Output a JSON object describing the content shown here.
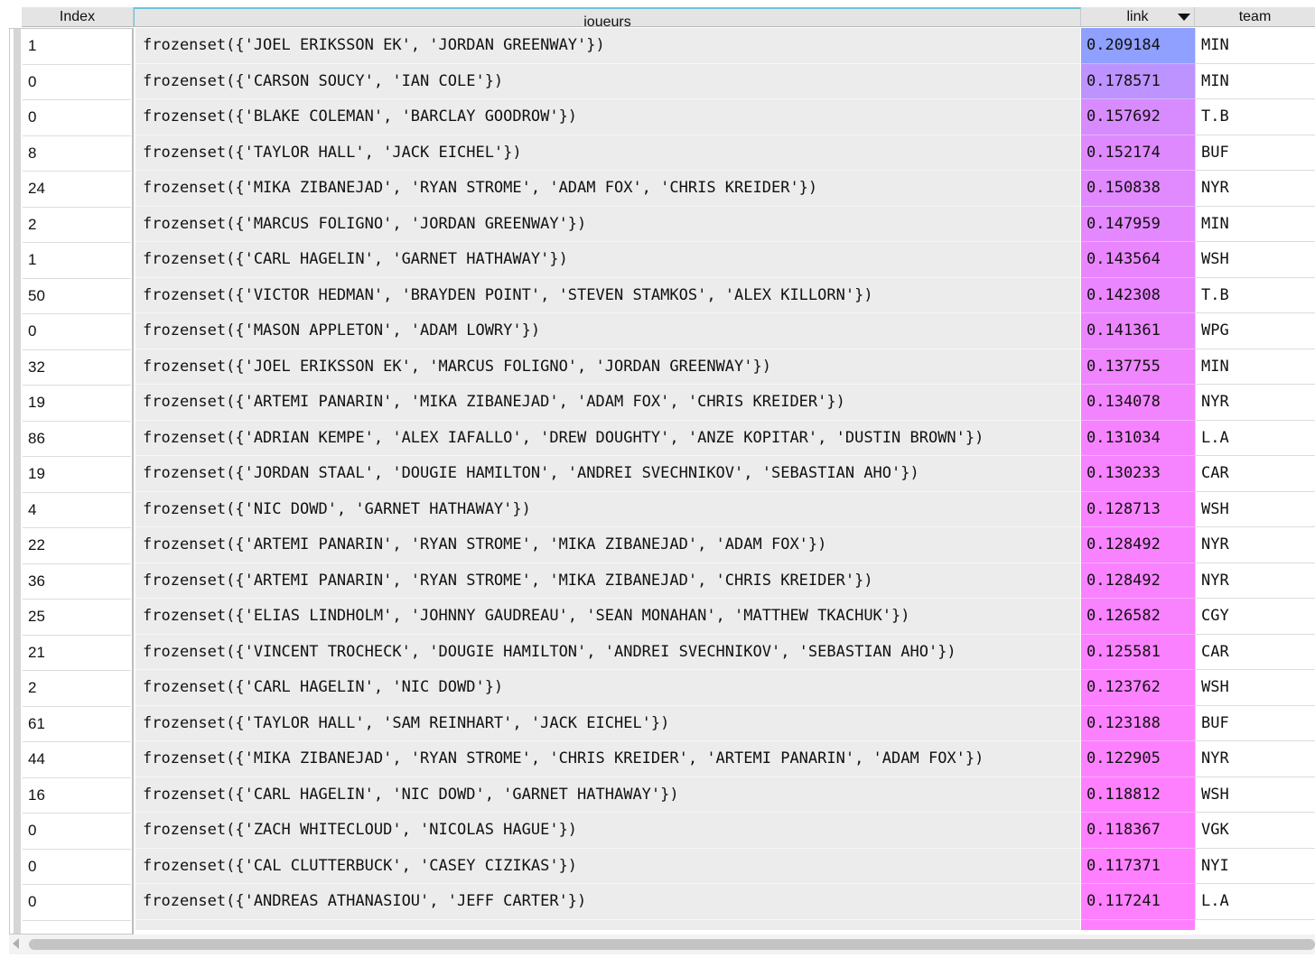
{
  "columns": {
    "index": "Index",
    "joueurs": "joueurs",
    "link": "link",
    "team": "team"
  },
  "colors": {
    "header_accent": "#6fc3d9",
    "link_low": "#ff80ff",
    "link_high": "#8fa0ff"
  },
  "rows": [
    {
      "index": "1",
      "joueurs": "frozenset({'JOEL ERIKSSON EK', 'JORDAN GREENWAY'})",
      "link": "0.209184",
      "team": "MIN"
    },
    {
      "index": "0",
      "joueurs": "frozenset({'CARSON SOUCY', 'IAN COLE'})",
      "link": "0.178571",
      "team": "MIN"
    },
    {
      "index": "0",
      "joueurs": "frozenset({'BLAKE COLEMAN', 'BARCLAY GOODROW'})",
      "link": "0.157692",
      "team": "T.B"
    },
    {
      "index": "8",
      "joueurs": "frozenset({'TAYLOR HALL', 'JACK EICHEL'})",
      "link": "0.152174",
      "team": "BUF"
    },
    {
      "index": "24",
      "joueurs": "frozenset({'MIKA ZIBANEJAD', 'RYAN STROME', 'ADAM FOX', 'CHRIS KREIDER'})",
      "link": "0.150838",
      "team": "NYR"
    },
    {
      "index": "2",
      "joueurs": "frozenset({'MARCUS FOLIGNO', 'JORDAN GREENWAY'})",
      "link": "0.147959",
      "team": "MIN"
    },
    {
      "index": "1",
      "joueurs": "frozenset({'CARL HAGELIN', 'GARNET HATHAWAY'})",
      "link": "0.143564",
      "team": "WSH"
    },
    {
      "index": "50",
      "joueurs": "frozenset({'VICTOR HEDMAN', 'BRAYDEN POINT', 'STEVEN STAMKOS', 'ALEX KILLORN'})",
      "link": "0.142308",
      "team": "T.B"
    },
    {
      "index": "0",
      "joueurs": "frozenset({'MASON APPLETON', 'ADAM LOWRY'})",
      "link": "0.141361",
      "team": "WPG"
    },
    {
      "index": "32",
      "joueurs": "frozenset({'JOEL ERIKSSON EK', 'MARCUS FOLIGNO', 'JORDAN GREENWAY'})",
      "link": "0.137755",
      "team": "MIN"
    },
    {
      "index": "19",
      "joueurs": "frozenset({'ARTEMI PANARIN', 'MIKA ZIBANEJAD', 'ADAM FOX', 'CHRIS KREIDER'})",
      "link": "0.134078",
      "team": "NYR"
    },
    {
      "index": "86",
      "joueurs": "frozenset({'ADRIAN KEMPE', 'ALEX IAFALLO', 'DREW DOUGHTY', 'ANZE KOPITAR', 'DUSTIN BROWN'})",
      "link": "0.131034",
      "team": "L.A"
    },
    {
      "index": "19",
      "joueurs": "frozenset({'JORDAN STAAL', 'DOUGIE HAMILTON', 'ANDREI SVECHNIKOV', 'SEBASTIAN AHO'})",
      "link": "0.130233",
      "team": "CAR"
    },
    {
      "index": "4",
      "joueurs": "frozenset({'NIC DOWD', 'GARNET HATHAWAY'})",
      "link": "0.128713",
      "team": "WSH"
    },
    {
      "index": "22",
      "joueurs": "frozenset({'ARTEMI PANARIN', 'RYAN STROME', 'MIKA ZIBANEJAD', 'ADAM FOX'})",
      "link": "0.128492",
      "team": "NYR"
    },
    {
      "index": "36",
      "joueurs": "frozenset({'ARTEMI PANARIN', 'RYAN STROME', 'MIKA ZIBANEJAD', 'CHRIS KREIDER'})",
      "link": "0.128492",
      "team": "NYR"
    },
    {
      "index": "25",
      "joueurs": "frozenset({'ELIAS LINDHOLM', 'JOHNNY GAUDREAU', 'SEAN MONAHAN', 'MATTHEW TKACHUK'})",
      "link": "0.126582",
      "team": "CGY"
    },
    {
      "index": "21",
      "joueurs": "frozenset({'VINCENT TROCHECK', 'DOUGIE HAMILTON', 'ANDREI SVECHNIKOV', 'SEBASTIAN AHO'})",
      "link": "0.125581",
      "team": "CAR"
    },
    {
      "index": "2",
      "joueurs": "frozenset({'CARL HAGELIN', 'NIC DOWD'})",
      "link": "0.123762",
      "team": "WSH"
    },
    {
      "index": "61",
      "joueurs": "frozenset({'TAYLOR HALL', 'SAM REINHART', 'JACK EICHEL'})",
      "link": "0.123188",
      "team": "BUF"
    },
    {
      "index": "44",
      "joueurs": "frozenset({'MIKA ZIBANEJAD', 'RYAN STROME', 'CHRIS KREIDER', 'ARTEMI PANARIN', 'ADAM FOX'})",
      "link": "0.122905",
      "team": "NYR"
    },
    {
      "index": "16",
      "joueurs": "frozenset({'CARL HAGELIN', 'NIC DOWD', 'GARNET HATHAWAY'})",
      "link": "0.118812",
      "team": "WSH"
    },
    {
      "index": "0",
      "joueurs": "frozenset({'ZACH WHITECLOUD', 'NICOLAS HAGUE'})",
      "link": "0.118367",
      "team": "VGK"
    },
    {
      "index": "0",
      "joueurs": "frozenset({'CAL CLUTTERBUCK', 'CASEY CIZIKAS'})",
      "link": "0.117371",
      "team": "NYI"
    },
    {
      "index": "0",
      "joueurs": "frozenset({'ANDREAS ATHANASIOU', 'JEFF CARTER'})",
      "link": "0.117241",
      "team": "L.A"
    }
  ]
}
